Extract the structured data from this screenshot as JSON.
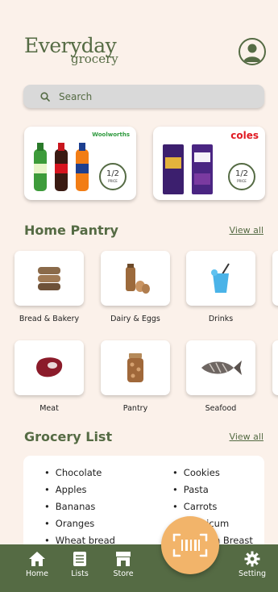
{
  "header": {
    "logo_line1": "Everyday",
    "logo_line2": "grocery"
  },
  "search": {
    "placeholder": "Search"
  },
  "promos": [
    {
      "store": "Woolworths",
      "badge_fraction": "1/2",
      "badge_text": "PRICE"
    },
    {
      "store": "coles",
      "badge_fraction": "1/2",
      "badge_text": "PRICE"
    }
  ],
  "home_pantry": {
    "title": "Home Pantry",
    "view_all": "View all",
    "categories": [
      "Bread & Bakery",
      "Dairy & Eggs",
      "Drinks",
      "Meat",
      "Pantry",
      "Seafood"
    ]
  },
  "grocery_list": {
    "title": "Grocery List",
    "view_all": "View all",
    "col1": [
      "Chocolate",
      "Apples",
      "Bananas",
      "Oranges",
      "Wheat bread"
    ],
    "col2": [
      "Cookies",
      "Pasta",
      "Carrots",
      "Capsicum",
      "Chicken Breast"
    ]
  },
  "nav": {
    "home": "Home",
    "lists": "Lists",
    "store": "Store",
    "setting": "Setting"
  },
  "colors": {
    "primary": "#556b44",
    "background": "#fbf1ea",
    "accent": "#f2b46a"
  }
}
